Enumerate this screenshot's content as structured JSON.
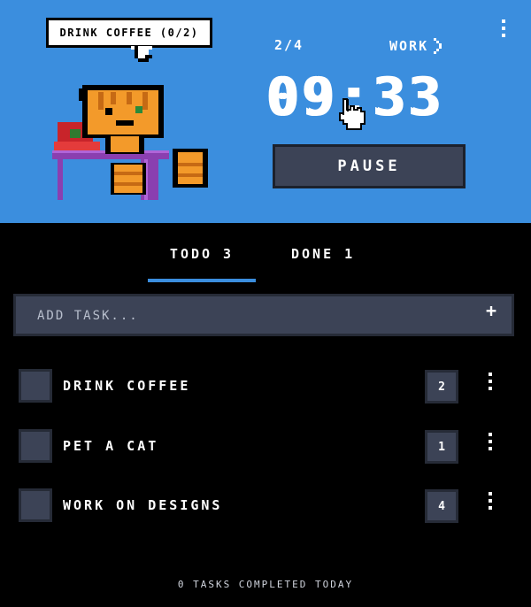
{
  "header": {
    "current_task_bubble": "DRINK COFFEE (0/2)",
    "session_count": "2/4",
    "mode_label": "WORK",
    "timer": "09:33",
    "pause_label": "PAUSE",
    "menu_icon": "vertical-dots-icon",
    "bg_color": "#3b8ede"
  },
  "tabs": [
    {
      "label": "TODO",
      "count": "3",
      "active": true
    },
    {
      "label": "DONE",
      "count": "1",
      "active": false
    }
  ],
  "add_task": {
    "placeholder": "ADD TASK...",
    "icon": "plus-icon"
  },
  "tasks": [
    {
      "label": "DRINK COFFEE",
      "count": "2"
    },
    {
      "label": "PET A CAT",
      "count": "1"
    },
    {
      "label": "WORK ON DESIGNS",
      "count": "4"
    }
  ],
  "footer": {
    "text": "0 TASKS COMPLETED TODAY"
  },
  "colors": {
    "accent": "#3b8ede",
    "panel": "#3c4356",
    "background": "#000000"
  }
}
